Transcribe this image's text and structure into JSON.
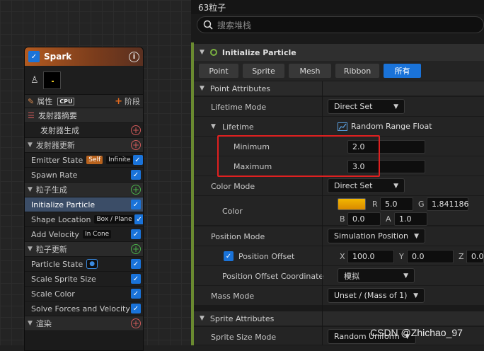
{
  "node": {
    "title": "Spark",
    "attr_label": "属性",
    "cpu_label": "CPU",
    "stage_label": "阶段",
    "rows": [
      {
        "label": "发射器摘要",
        "kind": "sec-list"
      },
      {
        "label": "发射器生成",
        "kind": "sub-add"
      },
      {
        "label": "发射器更新",
        "kind": "sec-add"
      },
      {
        "label": "Emitter State",
        "tags": [
          "Self",
          "Infinite"
        ],
        "checked": true
      },
      {
        "label": "Spawn Rate",
        "checked": true
      },
      {
        "label": "粒子生成",
        "kind": "sec-add-green"
      },
      {
        "label": "Initialize Particle",
        "checked": true,
        "selected": true
      },
      {
        "label": "Shape Location",
        "tags": [
          "Box / Plane"
        ],
        "checked": true
      },
      {
        "label": "Add Velocity",
        "tags": [
          "In Cone"
        ],
        "checked": true
      },
      {
        "label": "粒子更新",
        "kind": "sec-add-green"
      },
      {
        "label": "Particle State",
        "tags": [
          "●"
        ],
        "checked": true
      },
      {
        "label": "Scale Sprite Size",
        "checked": true
      },
      {
        "label": "Scale Color",
        "checked": true
      },
      {
        "label": "Solve Forces and Velocity",
        "checked": true
      },
      {
        "label": "渲染",
        "kind": "sec-add"
      }
    ]
  },
  "panel": {
    "title": "63粒子",
    "search_placeholder": "搜索堆栈",
    "section_title": "Initialize Particle",
    "filters": [
      "Point",
      "Sprite",
      "Mesh",
      "Ribbon",
      "所有"
    ],
    "active_filter": "所有",
    "point_attributes": "Point Attributes",
    "lifetime_mode": {
      "label": "Lifetime Mode",
      "value": "Direct Set"
    },
    "lifetime": {
      "label": "Lifetime",
      "value": "Random Range Float"
    },
    "minimum": {
      "label": "Minimum",
      "value": "2.0"
    },
    "maximum": {
      "label": "Maximum",
      "value": "3.0"
    },
    "color_mode": {
      "label": "Color Mode",
      "value": "Direct Set"
    },
    "color": {
      "label": "Color",
      "swatch": "#f2b600",
      "r": "5.0",
      "g": "1.841186",
      "b": "0.0",
      "a": "1.0"
    },
    "position_mode": {
      "label": "Position Mode",
      "value": "Simulation Position"
    },
    "position_offset": {
      "label": "Position Offset",
      "x": "100.0",
      "y": "0.0",
      "z": "0.0"
    },
    "position_offset_coordinate": {
      "label": "Position Offset Coordinate",
      "value": "模拟"
    },
    "mass_mode": {
      "label": "Mass Mode",
      "value": "Unset / (Mass of 1)"
    },
    "sprite_attributes": "Sprite Attributes",
    "sprite_size_mode": {
      "label": "Sprite Size Mode",
      "value": "Random Uniform"
    }
  },
  "watermark": "CSDN @Zhichao_97"
}
